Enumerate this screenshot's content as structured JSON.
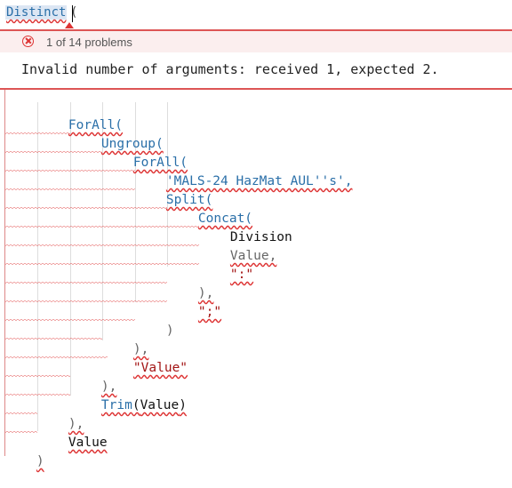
{
  "formula_bar": {
    "function_name": "Distinct",
    "open_paren": "("
  },
  "problems": {
    "summary": "1 of 14 problems",
    "message": "Invalid number of arguments: received 1, expected 2."
  },
  "code": {
    "line1": "ForAll(",
    "line2": "Ungroup(",
    "line3": "ForAll(",
    "line4": "'MALS-24 HazMat AUL''s',",
    "line5": "Split(",
    "line6": "Concat(",
    "line7": "Division",
    "line8": "Value,",
    "line9": "\":\"",
    "line10": "),",
    "line11": "\";\"",
    "line12": ")",
    "line13": "),",
    "line14": "\"Value\"",
    "line15": "),",
    "line16_fn": "Trim",
    "line16_open": "(",
    "line16_arg": "Value",
    "line16_close": ")",
    "line17": "),",
    "line18": "Value",
    "line19": ")"
  },
  "colors": {
    "keyword": "#2a6fa8",
    "string": "#a31515",
    "error": "#d33333"
  }
}
